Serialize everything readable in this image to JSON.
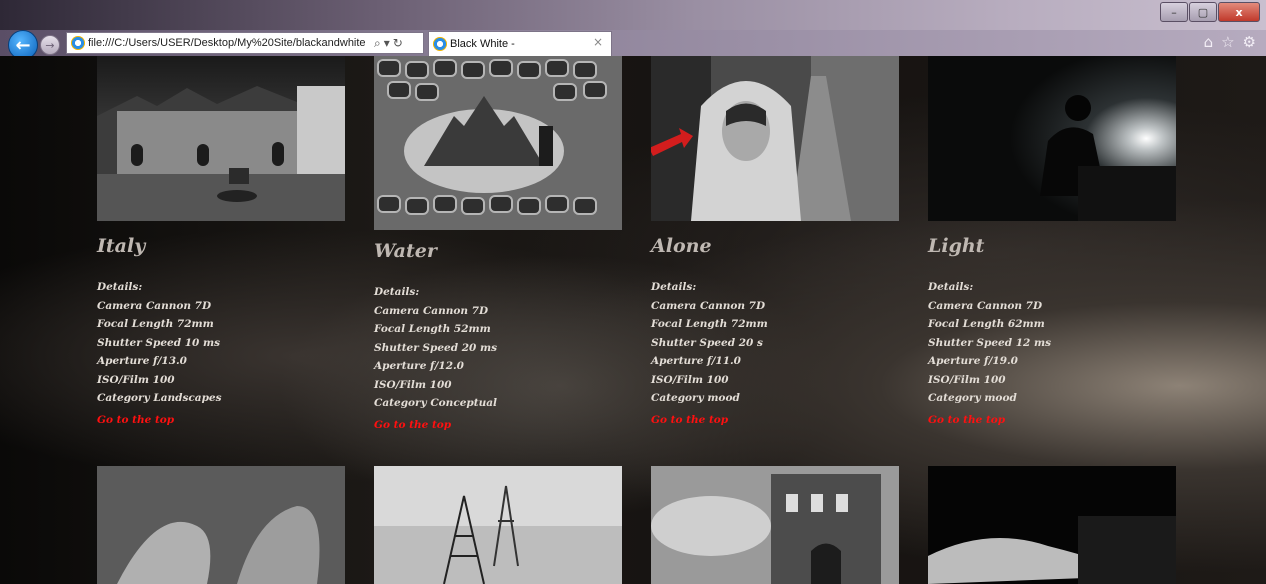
{
  "window": {
    "controls": {
      "minimize": "–",
      "maximize": "▢",
      "close": "x"
    }
  },
  "nav": {
    "address": "file:///C:/Users/USER/Desktop/My%20Site/blackandwhite",
    "tab_title": "Black White -",
    "tab_close": "×",
    "toolbar_icons": [
      "home-icon",
      "star-icon",
      "gear-icon"
    ]
  },
  "gallery": [
    {
      "title": "Italy",
      "details": [
        "Details:",
        "Camera Cannon 7D",
        "Focal Length 72mm",
        "Shutter Speed 10 ms",
        "Aperture f/13.0",
        "ISO/Film 100",
        "Category Landscapes"
      ],
      "link": "Go to the top"
    },
    {
      "title": "Water",
      "details": [
        "Details:",
        "Camera Cannon 7D",
        "Focal Length 52mm",
        "Shutter Speed 20 ms",
        "Aperture f/12.0",
        "ISO/Film 100",
        "Category Conceptual"
      ],
      "link": "Go to the top"
    },
    {
      "title": "Alone",
      "details": [
        "Details:",
        "Camera Cannon 7D",
        "Focal Length 72mm",
        "Shutter Speed 20 s",
        "Aperture f/11.0",
        "ISO/Film 100",
        "Category mood"
      ],
      "link": "Go to the top"
    },
    {
      "title": "Light",
      "details": [
        "Details:",
        "Camera Cannon 7D",
        "Focal Length 62mm",
        "Shutter Speed 12 ms",
        "Aperture f/19.0",
        "ISO/Film 100",
        "Category mood"
      ],
      "link": "Go to the top"
    }
  ],
  "colors": {
    "link": "#ff1010",
    "title": "#bfb8b2",
    "text": "#e3ddd6"
  }
}
